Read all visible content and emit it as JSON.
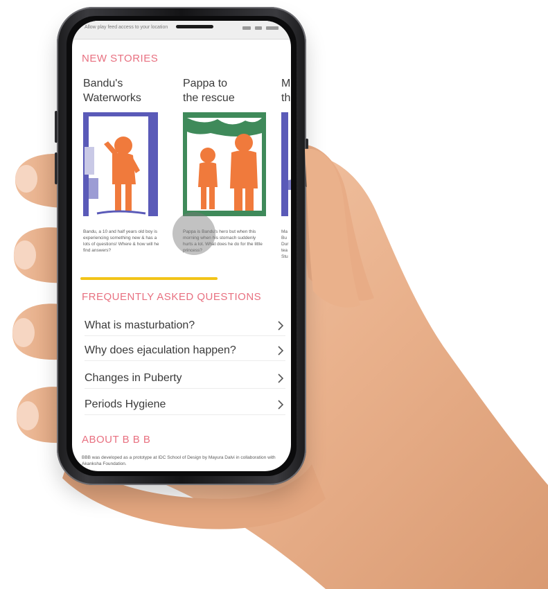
{
  "status_bar": {
    "text": "Allow play feed access to your location"
  },
  "new_stories": {
    "heading": "NEW STORIES",
    "stories": [
      {
        "title_line1": "Bandu's",
        "title_line2": "Waterworks",
        "description": "Bandu, a 10 and half years old boy is experiencing something new & has a lots of questions! Where & how will he find answers?"
      },
      {
        "title_line1": "Pappa to",
        "title_line2": "the rescue",
        "description": "Pappa is Bandu's hero but when this morning when his stomach suddenly hurts a lot. What does he do for the little princess?"
      },
      {
        "title_line1": "M",
        "title_line2": "th",
        "description": "Ma Bu Dur tea Stu"
      }
    ]
  },
  "faq": {
    "heading": "FREQUENTLY ASKED QUESTIONS",
    "items": [
      {
        "label": "What is masturbation?"
      },
      {
        "label": "Why does ejaculation happen?"
      },
      {
        "label": "Changes in Puberty"
      },
      {
        "label": "Periods Hygiene"
      }
    ]
  },
  "about": {
    "heading": "ABOUT B B B",
    "text": "BBB was developed as a prototype at IDC School of Design by Mayura Dalvi in collaboration with Akanksha Foundation."
  },
  "colors": {
    "accent_pink": "#e87080",
    "illustration_orange": "#f07a3c",
    "illustration_blue": "#5a5ab8",
    "illustration_green": "#3f8a5a",
    "divider_yellow": "#f2c418"
  }
}
